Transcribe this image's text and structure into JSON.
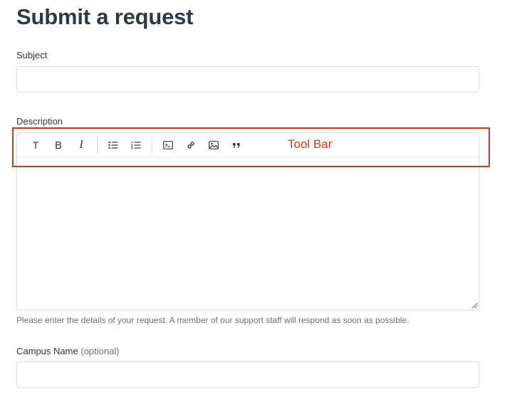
{
  "page": {
    "title": "Submit a request"
  },
  "subject": {
    "label": "Subject",
    "value": ""
  },
  "description": {
    "label": "Description",
    "value": "",
    "hint": "Please enter the details of your request. A member of our support staff will respond as soon as possible.",
    "toolbar": [
      {
        "name": "text-style-icon",
        "glyph": "T"
      },
      {
        "name": "bold-icon",
        "glyph": "B"
      },
      {
        "name": "italic-icon",
        "glyph": "I"
      },
      {
        "name": "bulleted-list-icon"
      },
      {
        "name": "numbered-list-icon"
      },
      {
        "name": "code-block-icon"
      },
      {
        "name": "link-icon"
      },
      {
        "name": "image-icon"
      },
      {
        "name": "quote-icon"
      }
    ]
  },
  "annotation": {
    "label": "Tool Bar",
    "color": "#cf3a1d"
  },
  "campus": {
    "label": "Campus Name",
    "optional_label": "(optional)",
    "value": ""
  }
}
